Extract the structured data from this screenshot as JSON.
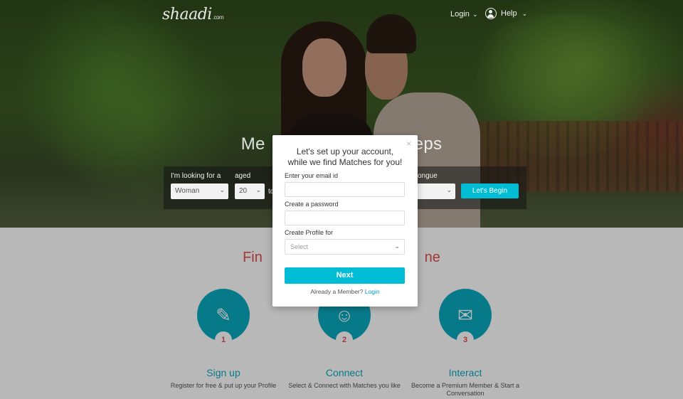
{
  "header": {
    "logo": "shaadi",
    "logo_suffix": ".com",
    "login": "Login",
    "help": "Help"
  },
  "hero": {
    "title": "Me                              eps"
  },
  "search": {
    "looking_for_label": "I'm looking for a",
    "looking_for_value": "Woman",
    "aged_label": "aged",
    "aged_from": "20",
    "to_label": "to",
    "tongue_label": "ongue",
    "tongue_value": "",
    "begin_button": "Let's Begin"
  },
  "section": {
    "title": "Fin                                         ne"
  },
  "steps": [
    {
      "num": "1",
      "title": "Sign up",
      "desc": "Register for free & put up your Profile",
      "icon": "edit-icon"
    },
    {
      "num": "2",
      "title": "Connect",
      "desc": "Select & Connect with Matches you like",
      "icon": "user-check-icon"
    },
    {
      "num": "3",
      "title": "Interact",
      "desc": "Become a Premium Member & Start a Conversation",
      "icon": "chat-icon"
    }
  ],
  "modal": {
    "title": "Let's set up your account, while we find Matches for you!",
    "email_label": "Enter your email id",
    "email_value": "",
    "password_label": "Create a password",
    "password_value": "",
    "profile_label": "Create Profile for",
    "profile_value": "Select",
    "next_button": "Next",
    "already_text": "Already a Member?",
    "login_link": "Login",
    "close": "×"
  },
  "colors": {
    "accent": "#00bcd5",
    "step_circle": "#0aaac0",
    "title_red": "#e24b4b"
  }
}
